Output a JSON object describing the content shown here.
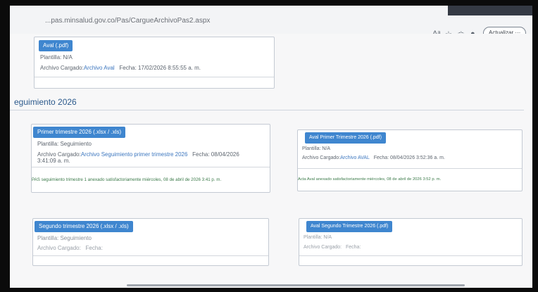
{
  "browser": {
    "url": "...pas.minsalud.gov.co/Pas/CargueArchivoPas2.aspx",
    "update_button": "Actualizar",
    "icons": [
      "read-aloud-icon",
      "favorite-icon",
      "extensions-icon",
      "profile-icon"
    ]
  },
  "aval_top": {
    "header": "Aval (.pdf)",
    "plantilla": "Plantilla: N/A",
    "archivo_label": "Archivo Cargado:",
    "archivo_link": "Archivo Aval",
    "fecha": "Fecha: 17/02/2026 8:55:55 a. m."
  },
  "section": {
    "title": "eguimiento 2026"
  },
  "primer_trimestre": {
    "header": "Primer trimestre 2026 (.xlsx / .xls)",
    "plantilla": "Plantilla: Seguimiento",
    "archivo_label": "Archivo Cargado:",
    "archivo_link": "Archivo Seguimiento primer trimestre 2026",
    "fecha": "Fecha: 08/04/2026",
    "fecha_time": "3:41:09 a. m.",
    "note": "PAS seguimiento trimestre 1 anexado satisfactoriamente miércoles, 08 de abril de 2026 3:41 p. m."
  },
  "aval_primer": {
    "header": "Aval Primer Trimestre 2026 (.pdf)",
    "plantilla": "Plantilla: N/A",
    "archivo_label": "Archivo Cargado:",
    "archivo_link": "Archivo AVAL",
    "fecha": "Fecha: 08/04/2026 3:52:36 a. m.",
    "note": "Acta Aval anexado satisfactoriamente miércoles, 08 de abril de 2026 3:52 p. m."
  },
  "segundo_trimestre": {
    "header": "Segundo trimestre 2026 (.xlsx / .xls)",
    "plantilla": "Plantilla: Seguimiento",
    "archivo_label": "Archivo Cargado:",
    "fecha": "Fecha:"
  },
  "aval_segundo": {
    "header": "Aval Segundo Trimestre 2026 (.pdf)",
    "plantilla": "Plantilla: N/A",
    "archivo_label": "Archivo Cargado:",
    "fecha": "Fecha:"
  }
}
